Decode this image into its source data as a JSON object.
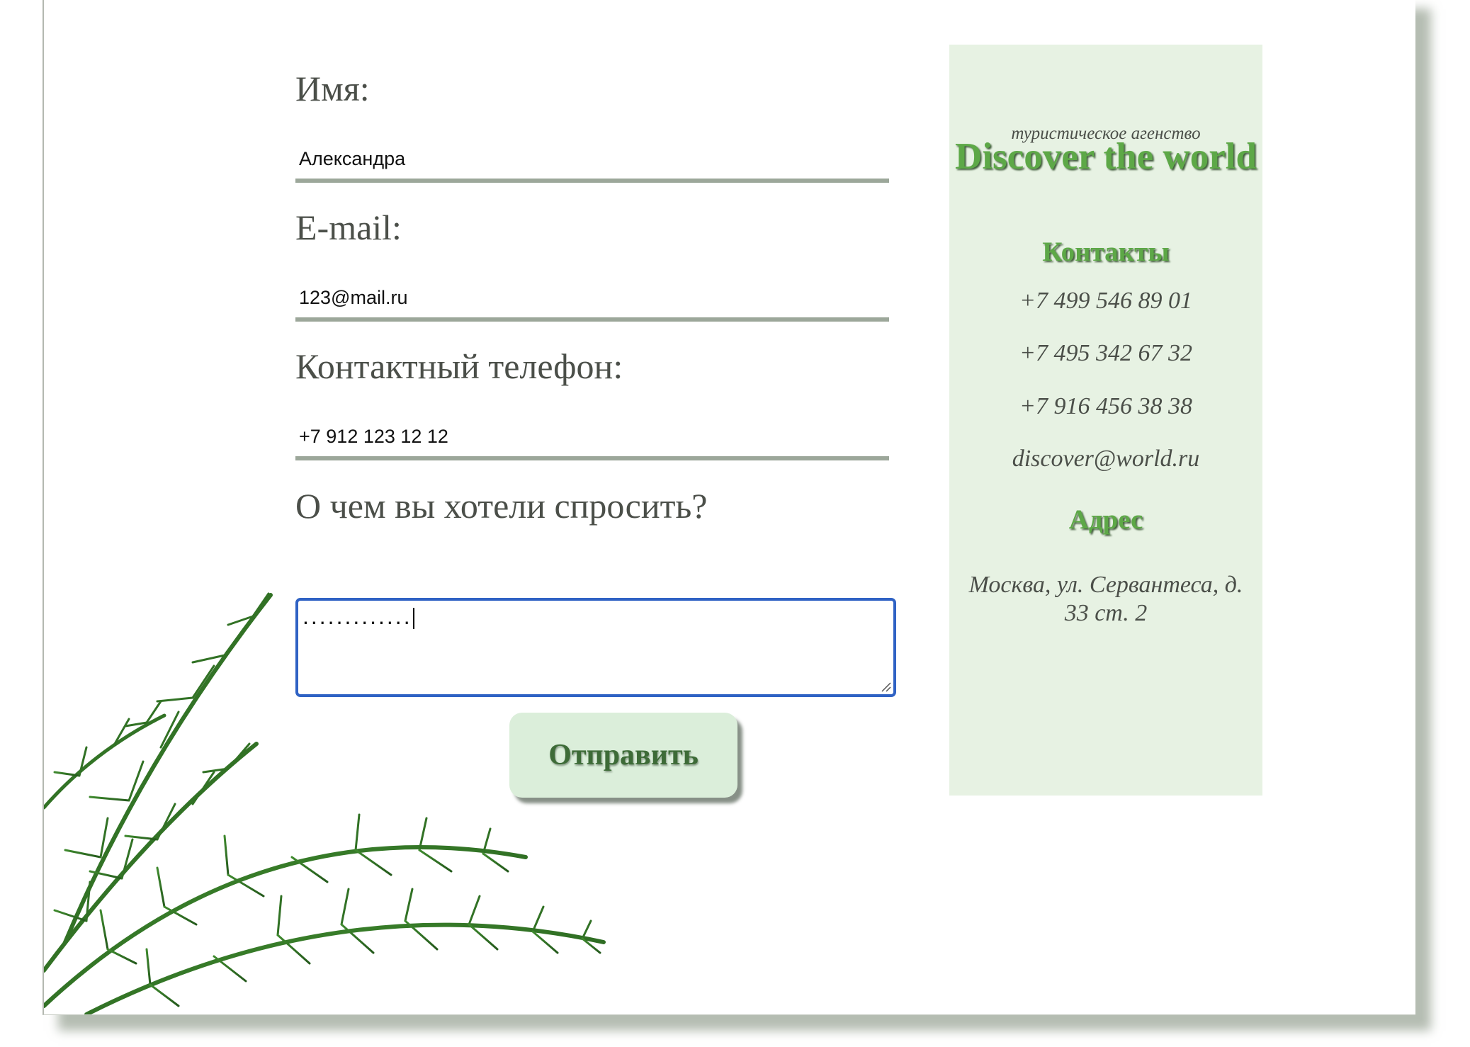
{
  "form": {
    "name_label": "Имя:",
    "name_value": "Александра",
    "email_label": "E-mail:",
    "email_value": "123@mail.ru",
    "phone_label": "Контактный телефон:",
    "phone_value": "+7 912 123 12 12",
    "question_label": "О чем вы хотели спросить?",
    "question_value": ".............",
    "submit_label": "Отправить"
  },
  "sidebar": {
    "tagline": "туристическое агенство",
    "brand": "Discover the world",
    "contacts_heading": "Контакты",
    "phones": [
      "+7 499 546 89 01",
      "+7 495 342 67 32",
      "+7 916 456 38 38"
    ],
    "email": "discover@world.ru",
    "address_heading": "Адрес",
    "address": "Москва, ул. Сервантеса, д. 33 ст. 2"
  },
  "colors": {
    "accent_green": "#5da847",
    "input_underline": "#9ca79a",
    "sidebar_bg": "#e7f2e3",
    "button_bg": "#dbeeda",
    "focus_border": "#2f62c4"
  },
  "icons": {
    "decoration": "palm-leaves-icon",
    "textarea_resize": "resize-grip-icon"
  }
}
